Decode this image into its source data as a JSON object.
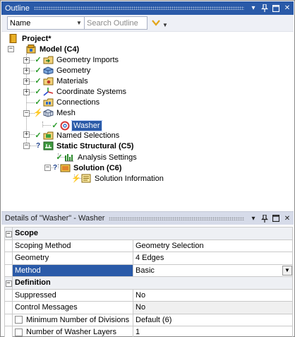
{
  "outline": {
    "title": "Outline",
    "buttons": [
      "▾",
      "ᛘ",
      "☐",
      "✕"
    ],
    "toolbar": {
      "name_combo": "Name",
      "search_placeholder": "Search Outline"
    },
    "tree": [
      {
        "label": "Project*",
        "bold": true,
        "icon": "project-icon"
      },
      {
        "label": "Model (C4)",
        "bold": true,
        "icon": "model-icon"
      },
      {
        "label": "Geometry Imports",
        "icon": "geometry-imports-icon",
        "status": "check"
      },
      {
        "label": "Geometry",
        "icon": "geometry-icon",
        "status": "check"
      },
      {
        "label": "Materials",
        "icon": "materials-icon",
        "status": "check"
      },
      {
        "label": "Coordinate Systems",
        "icon": "coordinate-systems-icon",
        "status": "check"
      },
      {
        "label": "Connections",
        "icon": "connections-icon",
        "status": "check"
      },
      {
        "label": "Mesh",
        "icon": "mesh-icon",
        "status": "lightning"
      },
      {
        "label": "Washer",
        "icon": "washer-icon",
        "status": "check",
        "selected": true
      },
      {
        "label": "Named Selections",
        "icon": "named-selections-icon",
        "status": "check"
      },
      {
        "label": "Static Structural (C5)",
        "bold": true,
        "icon": "static-structural-icon",
        "status": "question"
      },
      {
        "label": "Analysis Settings",
        "icon": "analysis-settings-icon",
        "status": "check"
      },
      {
        "label": "Solution (C6)",
        "bold": true,
        "icon": "solution-icon",
        "status": "question"
      },
      {
        "label": "Solution Information",
        "icon": "solution-information-icon",
        "status": "lightning"
      }
    ]
  },
  "details": {
    "title": "Details of \"Washer\" - Washer",
    "buttons": [
      "▾",
      "ᛘ",
      "☐",
      "✕"
    ],
    "sections": [
      {
        "name": "Scope",
        "rows": [
          {
            "key": "Scoping Method",
            "value": "Geometry Selection"
          },
          {
            "key": "Geometry",
            "value": "4 Edges"
          },
          {
            "key": "Method",
            "value": "Basic",
            "selected": true,
            "dropdown": true
          }
        ]
      },
      {
        "name": "Definition",
        "rows": [
          {
            "key": "Suppressed",
            "value": "No"
          },
          {
            "key": "Control Messages",
            "value": "No",
            "shaded": true
          },
          {
            "key": "Minimum Number of Divisions",
            "value": "Default (6)",
            "checkbox": true
          },
          {
            "key": "Number of Washer Layers",
            "value": "1",
            "checkbox": true
          }
        ]
      }
    ]
  }
}
